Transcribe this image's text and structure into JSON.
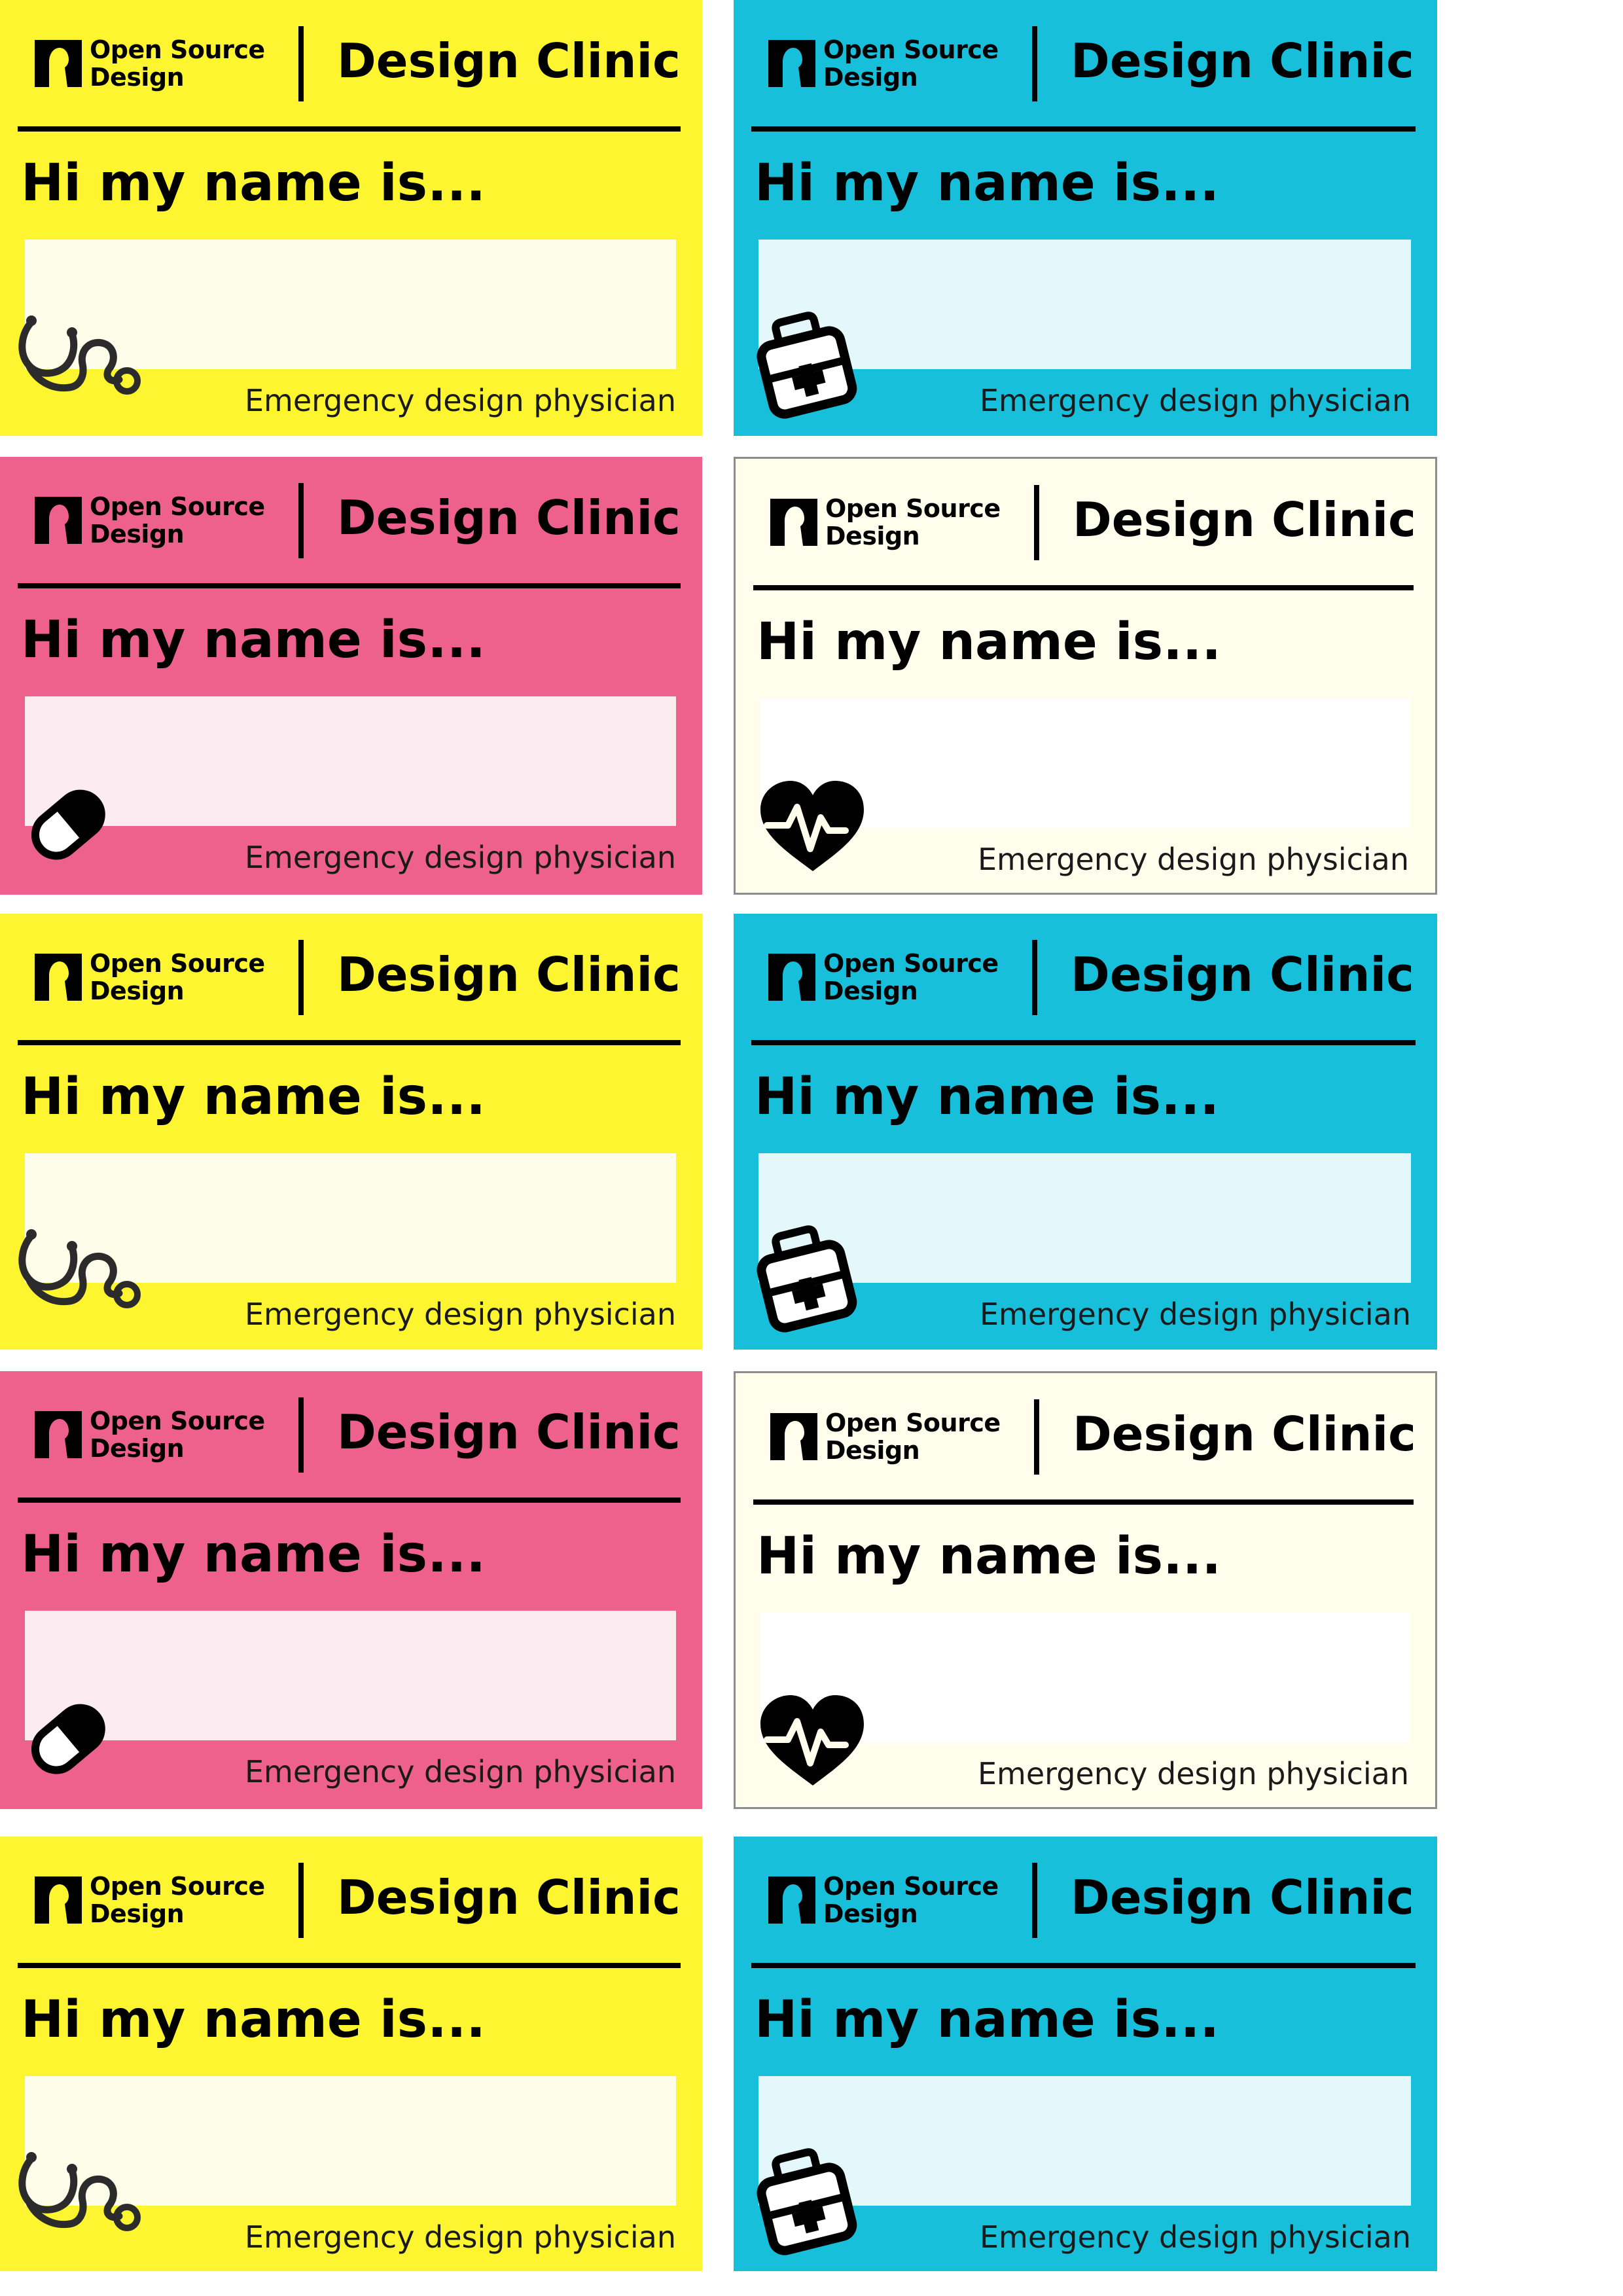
{
  "colors": {
    "yellow": "#fef531",
    "cyan": "#17bfdb",
    "pink": "#ee608d",
    "cream": "#fffeec",
    "ink": "#000000"
  },
  "badge": {
    "logo_line1": "Open Source",
    "logo_line2": "Design",
    "clinic": "Design Clinic",
    "greeting": "Hi my name is...",
    "role": "Emergency design physician"
  },
  "badges": [
    {
      "color": "yellow",
      "icon": "stethoscope-icon"
    },
    {
      "color": "cyan",
      "icon": "medical-kit-icon"
    },
    {
      "color": "pink",
      "icon": "pill-capsule-icon"
    },
    {
      "color": "cream",
      "icon": "heart-pulse-icon"
    },
    {
      "color": "yellow",
      "icon": "stethoscope-icon"
    },
    {
      "color": "cyan",
      "icon": "medical-kit-icon"
    },
    {
      "color": "pink",
      "icon": "pill-capsule-icon"
    },
    {
      "color": "cream",
      "icon": "heart-pulse-icon"
    },
    {
      "color": "yellow",
      "icon": "stethoscope-icon"
    },
    {
      "color": "cyan",
      "icon": "medical-kit-icon"
    }
  ]
}
